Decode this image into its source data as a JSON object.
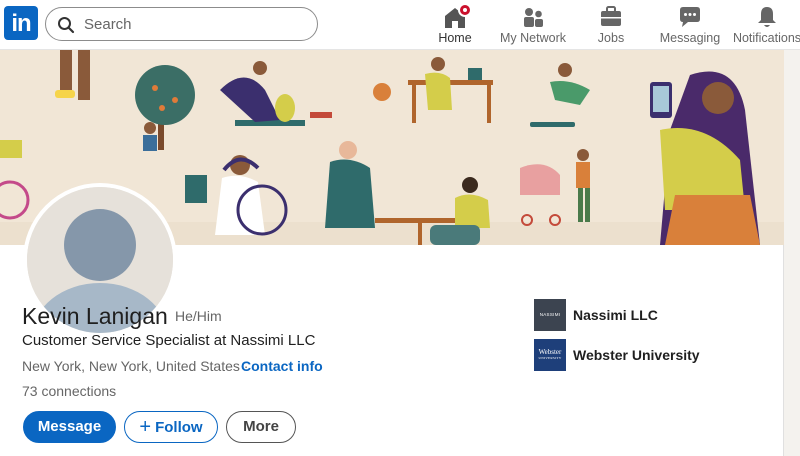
{
  "nav": {
    "logo_text": "in",
    "search_placeholder": "Search",
    "items": [
      {
        "label": "Home",
        "icon": "home-icon",
        "active": true,
        "notification": true
      },
      {
        "label": "My Network",
        "icon": "network-icon"
      },
      {
        "label": "Jobs",
        "icon": "briefcase-icon"
      },
      {
        "label": "Messaging",
        "icon": "messaging-icon"
      },
      {
        "label": "Notifications",
        "icon": "bell-icon"
      }
    ]
  },
  "profile": {
    "name": "Kevin Lanigan",
    "pronouns": "He/Him",
    "headline": "Customer Service Specialist at Nassimi LLC",
    "location": "New York, New York, United States ·",
    "contact_info": "Contact info",
    "connections": "73 connections"
  },
  "actions": {
    "message": "Message",
    "follow": "Follow",
    "more": "More"
  },
  "organizations": [
    {
      "name": "Nassimi LLC",
      "logo_text": "NASSIMI"
    },
    {
      "name": "Webster University",
      "logo_text": "Webster",
      "logo_subtext": "UNIVERSITY"
    }
  ],
  "colors": {
    "brand": "#0a66c2",
    "notification": "#cb112d",
    "banner_bg": "#f1e6d6"
  }
}
